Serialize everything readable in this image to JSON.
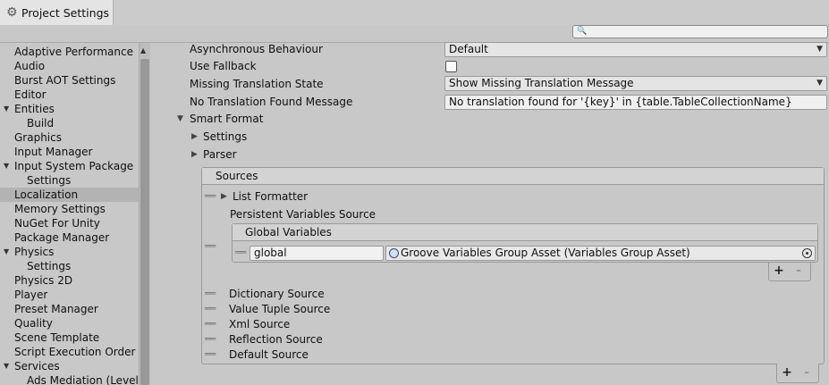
{
  "window": {
    "tab_title": "Project Settings",
    "icon": "gear-icon"
  },
  "search": {
    "placeholder": "",
    "icon": "search-icon"
  },
  "sidebar": {
    "items": [
      {
        "label": "Adaptive Performance"
      },
      {
        "label": "Audio"
      },
      {
        "label": "Burst AOT Settings"
      },
      {
        "label": "Editor"
      },
      {
        "label": "Entities"
      },
      {
        "label": "Build"
      },
      {
        "label": "Graphics"
      },
      {
        "label": "Input Manager"
      },
      {
        "label": "Input System Package"
      },
      {
        "label": "Settings"
      },
      {
        "label": "Localization"
      },
      {
        "label": "Memory Settings"
      },
      {
        "label": "NuGet For Unity"
      },
      {
        "label": "Package Manager"
      },
      {
        "label": "Physics"
      },
      {
        "label": "Settings"
      },
      {
        "label": "Physics 2D"
      },
      {
        "label": "Player"
      },
      {
        "label": "Preset Manager"
      },
      {
        "label": "Quality"
      },
      {
        "label": "Scene Template"
      },
      {
        "label": "Script Execution Order"
      },
      {
        "label": "Services"
      },
      {
        "label": "Ads Mediation (LevelP"
      }
    ],
    "selected": "Localization"
  },
  "main": {
    "async_label": "Asynchronous Behaviour",
    "async_value": "Default",
    "fallback_label": "Use Fallback",
    "fallback_checked": false,
    "missing_state_label": "Missing Translation State",
    "missing_state_value": "Show Missing Translation Message",
    "no_translation_label": "No Translation Found Message",
    "no_translation_value": "No translation found for '{key}' in {table.TableCollectionName}",
    "smart_format_label": "Smart Format",
    "settings_label": "Settings",
    "parser_label": "Parser",
    "sources": {
      "header": "Sources",
      "list_formatter": "List Formatter",
      "persistent_label": "Persistent Variables Source",
      "global_header": "Global Variables",
      "global_key": "global",
      "global_value": "Groove Variables Group Asset (Variables Group Asset)",
      "items": [
        "Dictionary Source",
        "Value Tuple Source",
        "Xml Source",
        "Reflection Source",
        "Default Source"
      ],
      "add": "+",
      "remove": "-"
    }
  }
}
